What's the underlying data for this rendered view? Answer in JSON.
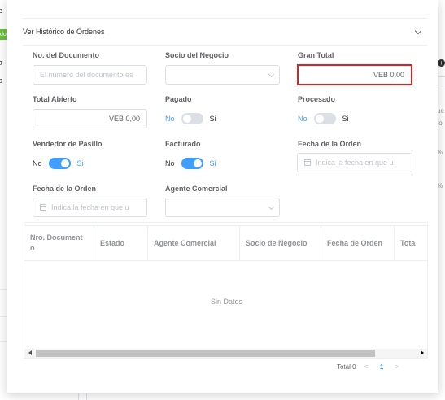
{
  "background": {
    "left_letters": [
      "e",
      "a",
      "o"
    ],
    "left_badge": "do",
    "right_letters": [
      "ue",
      "to",
      "%",
      "%"
    ]
  },
  "collapse": {
    "title": "Ver Histórico de Órdenes"
  },
  "form": {
    "documento": {
      "label": "No. del Documento",
      "placeholder": "El número del documento es"
    },
    "socio": {
      "label": "Socio del Negocio",
      "value": ""
    },
    "gran_total": {
      "label": "Gran Total",
      "value": "VEB 0,00"
    },
    "total_abierto": {
      "label": "Total Abierto",
      "value": "VEB 0,00"
    },
    "pagado": {
      "label": "Pagado",
      "no": "No",
      "si": "Si",
      "on": false
    },
    "procesado": {
      "label": "Procesado",
      "no": "No",
      "si": "Si",
      "on": false
    },
    "vendedor": {
      "label": "Vendedor de Pasillo",
      "no": "No",
      "si": "Si",
      "on": true
    },
    "facturado": {
      "label": "Facturado",
      "no": "No",
      "si": "Si",
      "on": true
    },
    "fecha_orden_1": {
      "label": "Fecha de la Orden",
      "placeholder": "Indica la fecha en que u"
    },
    "fecha_orden_2": {
      "label": "Fecha de la Orden",
      "placeholder": "Indica la fecha en que u"
    },
    "agente": {
      "label": "Agente Comercial",
      "value": ""
    }
  },
  "table": {
    "columns": [
      "Nro. Document o",
      "Estado",
      "Agente Comercial",
      "Socio de Negocio",
      "Fecha de Orden",
      "Tota"
    ],
    "empty_text": "Sin Datos"
  },
  "pagination": {
    "total": "Total 0",
    "prev": "<",
    "page": "1",
    "next": ">"
  }
}
